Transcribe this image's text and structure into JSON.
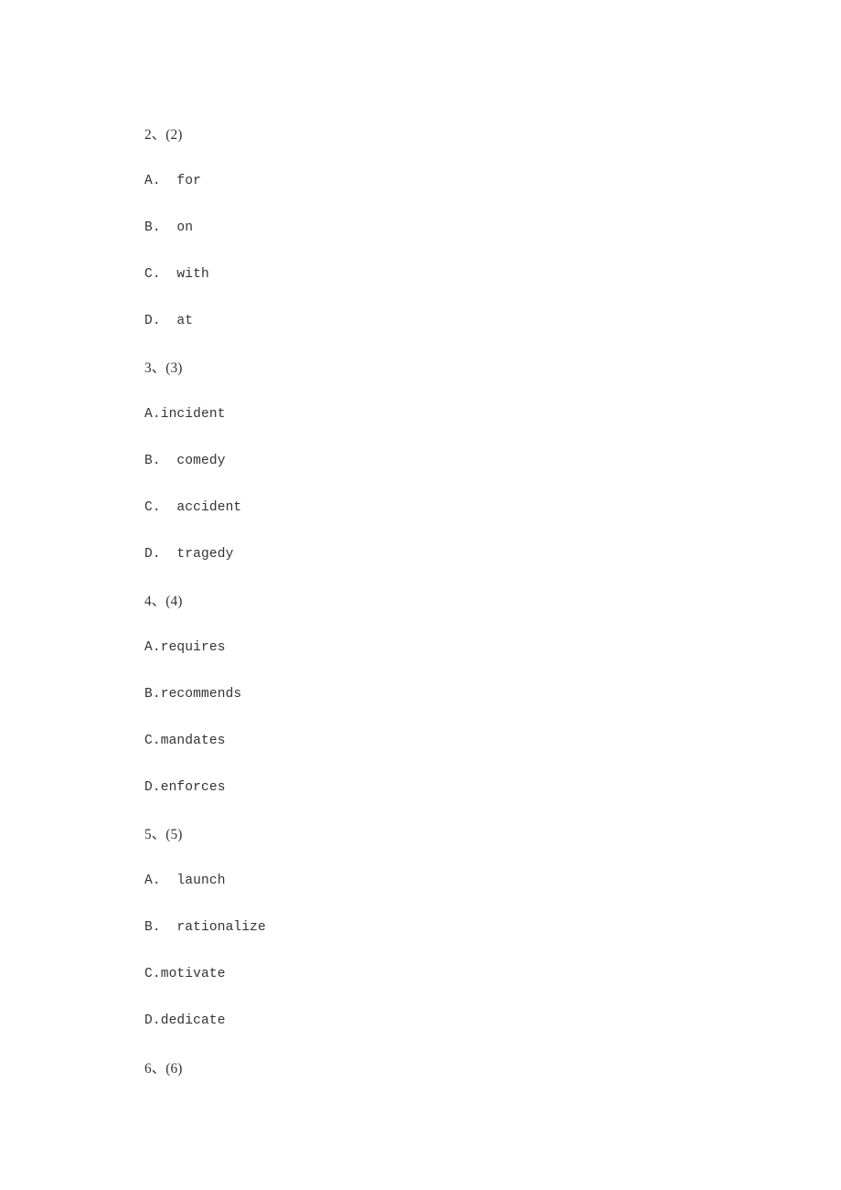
{
  "page": {
    "background_color": "#ffffff",
    "text_color": "#333333",
    "kind": "exam-answer-options-page"
  },
  "questions": [
    {
      "number_label": "2、(2)",
      "options": [
        {
          "label": "A.  for"
        },
        {
          "label": "B.  on"
        },
        {
          "label": "C.  with"
        },
        {
          "label": "D.  at"
        }
      ]
    },
    {
      "number_label": "3、(3)",
      "options": [
        {
          "label": "A.incident"
        },
        {
          "label": "B.  comedy"
        },
        {
          "label": "C.  accident"
        },
        {
          "label": "D.  tragedy"
        }
      ]
    },
    {
      "number_label": "4、(4)",
      "options": [
        {
          "label": "A.requires"
        },
        {
          "label": "B.recommends"
        },
        {
          "label": "C.mandates"
        },
        {
          "label": "D.enforces"
        }
      ]
    },
    {
      "number_label": "5、(5)",
      "options": [
        {
          "label": "A.  launch"
        },
        {
          "label": "B.  rationalize"
        },
        {
          "label": "C.motivate"
        },
        {
          "label": "D.dedicate"
        }
      ]
    },
    {
      "number_label": "6、(6)",
      "options": []
    }
  ],
  "lines": [
    {
      "text": "2、(2)",
      "role": "question-number"
    },
    {
      "text": "A.  for",
      "role": "option"
    },
    {
      "text": "B.  on",
      "role": "option"
    },
    {
      "text": "C.  with",
      "role": "option"
    },
    {
      "text": "D.  at",
      "role": "option"
    },
    {
      "text": "3、(3)",
      "role": "question-number"
    },
    {
      "text": "A.incident",
      "role": "option"
    },
    {
      "text": "B.  comedy",
      "role": "option"
    },
    {
      "text": "C.  accident",
      "role": "option"
    },
    {
      "text": "D.  tragedy",
      "role": "option"
    },
    {
      "text": "4、(4)",
      "role": "question-number"
    },
    {
      "text": "A.requires",
      "role": "option"
    },
    {
      "text": "B.recommends",
      "role": "option"
    },
    {
      "text": "C.mandates",
      "role": "option"
    },
    {
      "text": "D.enforces",
      "role": "option"
    },
    {
      "text": "5、(5)",
      "role": "question-number"
    },
    {
      "text": "A.  launch",
      "role": "option"
    },
    {
      "text": "B.  rationalize",
      "role": "option"
    },
    {
      "text": "C.motivate",
      "role": "option"
    },
    {
      "text": "D.dedicate",
      "role": "option"
    },
    {
      "text": "6、(6)",
      "role": "question-number"
    }
  ]
}
